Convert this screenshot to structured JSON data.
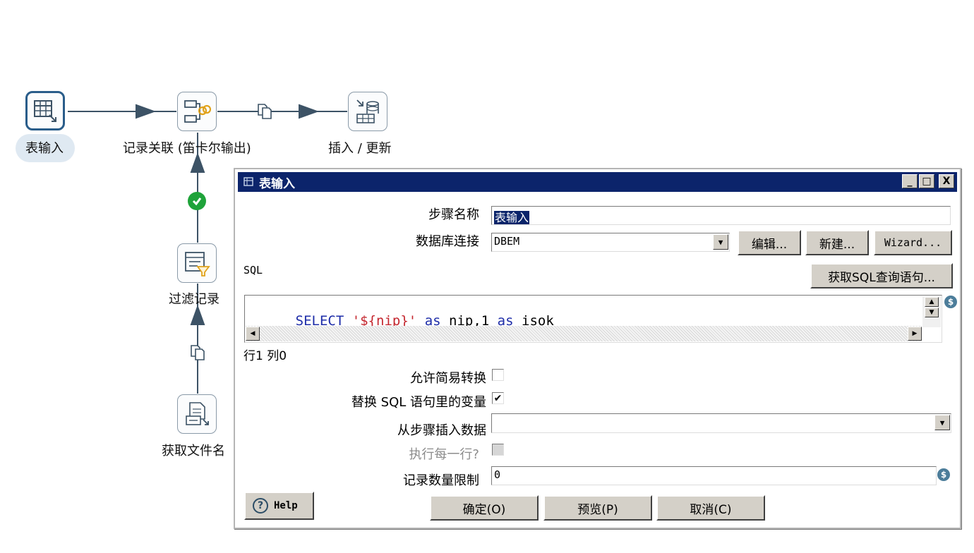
{
  "canvas": {
    "nodes": [
      {
        "id": "table-input",
        "label": "表输入"
      },
      {
        "id": "join",
        "label": "记录关联 (笛卡尔输出)"
      },
      {
        "id": "insert-update",
        "label": "插入 / 更新"
      },
      {
        "id": "filter",
        "label": "过滤记录"
      },
      {
        "id": "get-filenames",
        "label": "获取文件名"
      }
    ],
    "hop_icons": [
      "copy-rows-icon",
      "copy-rows-icon"
    ],
    "check_icon": "check-circle-icon",
    "colors": {
      "hop": "#3d5366",
      "selected_border": "#2a5d8a",
      "check": "#1fa33a"
    }
  },
  "dialog": {
    "title": "表输入",
    "title_colors": {
      "bar": "#0c246b",
      "text": "#ffffff"
    },
    "window_buttons": [
      "_",
      "□",
      "X"
    ],
    "step_name_label": "步骤名称",
    "step_name_value": "表输入",
    "db_connection_label": "数据库连接",
    "db_connection_value": "DBEM",
    "edit_button": "编辑...",
    "new_button": "新建...",
    "wizard_button": "Wizard...",
    "sql_label": "SQL",
    "get_sql_button": "获取SQL查询语句...",
    "sql": {
      "tokens": [
        {
          "text": "SELECT",
          "type": "keyword"
        },
        {
          "text": " ",
          "type": "plain"
        },
        {
          "text": "'${nip}'",
          "type": "string"
        },
        {
          "text": " ",
          "type": "plain"
        },
        {
          "text": "as",
          "type": "keyword"
        },
        {
          "text": " nip,1 ",
          "type": "plain"
        },
        {
          "text": "as",
          "type": "keyword"
        },
        {
          "text": " isok",
          "type": "plain"
        }
      ]
    },
    "cursor_position": "行1 列0",
    "lazy_conversion_label": "允许简易转换",
    "lazy_conversion_checked": false,
    "replace_vars_label": "替换 SQL 语句里的变量",
    "replace_vars_checked": true,
    "insert_from_step_label": "从步骤插入数据",
    "insert_from_step_value": "",
    "execute_each_row_label": "执行每一行?",
    "execute_each_row_checked": false,
    "limit_label": "记录数量限制",
    "limit_value": "0",
    "help_button": "Help",
    "ok_button": "确定(O)",
    "preview_button": "预览(P)",
    "cancel_button": "取消(C)"
  }
}
